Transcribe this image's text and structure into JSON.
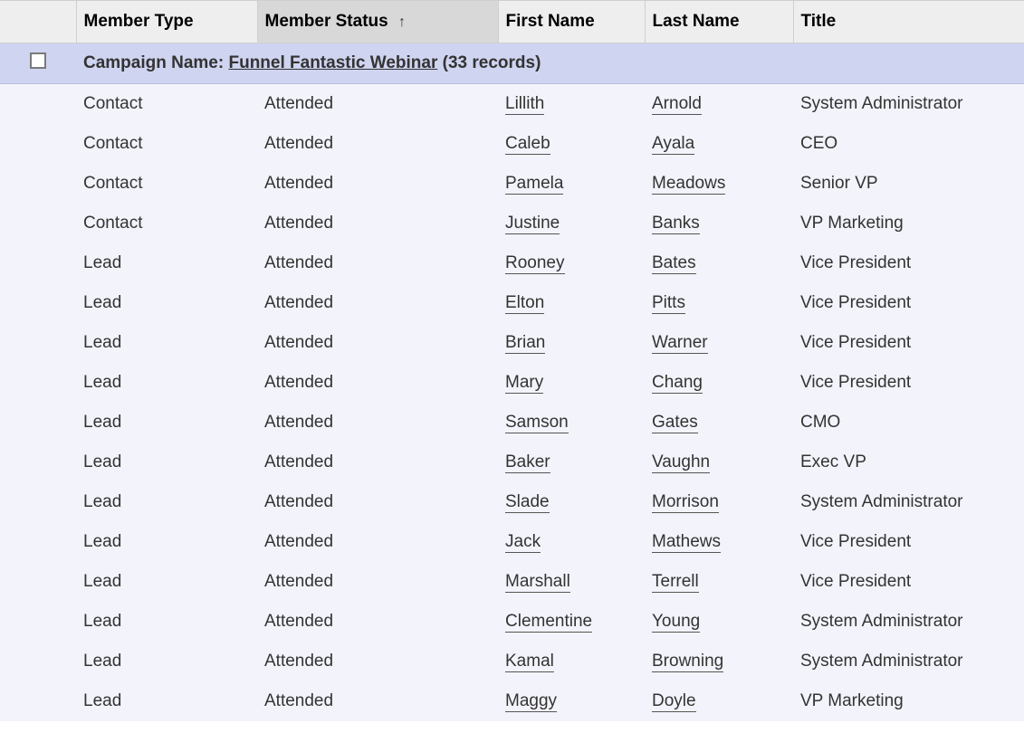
{
  "columns": {
    "member_type": "Member Type",
    "member_status": "Member Status",
    "first_name": "First Name",
    "last_name": "Last Name",
    "title": "Title"
  },
  "sort": {
    "column": "member_status",
    "direction_glyph": "↑"
  },
  "group": {
    "label": "Campaign Name:",
    "name": "Funnel Fantastic Webinar",
    "count_text": "(33 records)"
  },
  "rows": [
    {
      "member_type": "Contact",
      "member_status": "Attended",
      "first_name": "Lillith",
      "last_name": "Arnold",
      "title": "System Administrator"
    },
    {
      "member_type": "Contact",
      "member_status": "Attended",
      "first_name": "Caleb",
      "last_name": "Ayala",
      "title": "CEO"
    },
    {
      "member_type": "Contact",
      "member_status": "Attended",
      "first_name": "Pamela",
      "last_name": "Meadows",
      "title": "Senior VP"
    },
    {
      "member_type": "Contact",
      "member_status": "Attended",
      "first_name": "Justine",
      "last_name": "Banks",
      "title": "VP Marketing"
    },
    {
      "member_type": "Lead",
      "member_status": "Attended",
      "first_name": "Rooney",
      "last_name": "Bates",
      "title": "Vice President"
    },
    {
      "member_type": "Lead",
      "member_status": "Attended",
      "first_name": "Elton",
      "last_name": "Pitts",
      "title": "Vice President"
    },
    {
      "member_type": "Lead",
      "member_status": "Attended",
      "first_name": "Brian",
      "last_name": "Warner",
      "title": "Vice President"
    },
    {
      "member_type": "Lead",
      "member_status": "Attended",
      "first_name": "Mary",
      "last_name": "Chang",
      "title": "Vice President"
    },
    {
      "member_type": "Lead",
      "member_status": "Attended",
      "first_name": "Samson",
      "last_name": "Gates",
      "title": "CMO"
    },
    {
      "member_type": "Lead",
      "member_status": "Attended",
      "first_name": "Baker",
      "last_name": "Vaughn",
      "title": "Exec VP"
    },
    {
      "member_type": "Lead",
      "member_status": "Attended",
      "first_name": "Slade",
      "last_name": "Morrison",
      "title": "System Administrator"
    },
    {
      "member_type": "Lead",
      "member_status": "Attended",
      "first_name": "Jack",
      "last_name": "Mathews",
      "title": "Vice President"
    },
    {
      "member_type": "Lead",
      "member_status": "Attended",
      "first_name": "Marshall",
      "last_name": "Terrell",
      "title": "Vice President"
    },
    {
      "member_type": "Lead",
      "member_status": "Attended",
      "first_name": "Clementine",
      "last_name": "Young",
      "title": "System Administrator"
    },
    {
      "member_type": "Lead",
      "member_status": "Attended",
      "first_name": "Kamal",
      "last_name": "Browning",
      "title": "System Administrator"
    },
    {
      "member_type": "Lead",
      "member_status": "Attended",
      "first_name": "Maggy",
      "last_name": "Doyle",
      "title": "VP Marketing"
    }
  ]
}
